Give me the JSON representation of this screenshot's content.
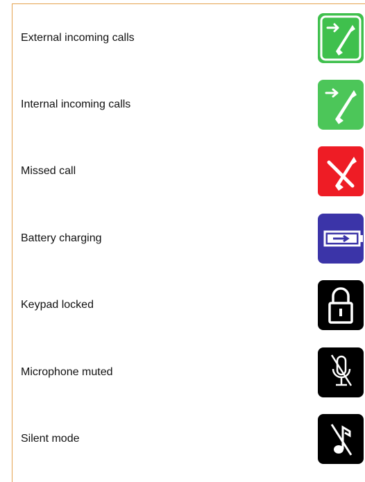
{
  "rows": [
    {
      "label": "External incoming calls",
      "icon": "external-incoming-call-icon",
      "color": "#3fc04d"
    },
    {
      "label": "Internal incoming calls",
      "icon": "internal-incoming-call-icon",
      "color": "#4cc659"
    },
    {
      "label": "Missed call",
      "icon": "missed-call-icon",
      "color": "#ee1c25"
    },
    {
      "label": "Battery charging",
      "icon": "battery-charging-icon",
      "color": "#3b34a8"
    },
    {
      "label": "Keypad locked",
      "icon": "lock-icon",
      "color": "#000000"
    },
    {
      "label": "Microphone muted",
      "icon": "microphone-muted-icon",
      "color": "#000000"
    },
    {
      "label": "Silent mode",
      "icon": "silent-mode-icon",
      "color": "#000000"
    }
  ],
  "colors": {
    "border": "#e5a24e",
    "text": "#111111"
  }
}
